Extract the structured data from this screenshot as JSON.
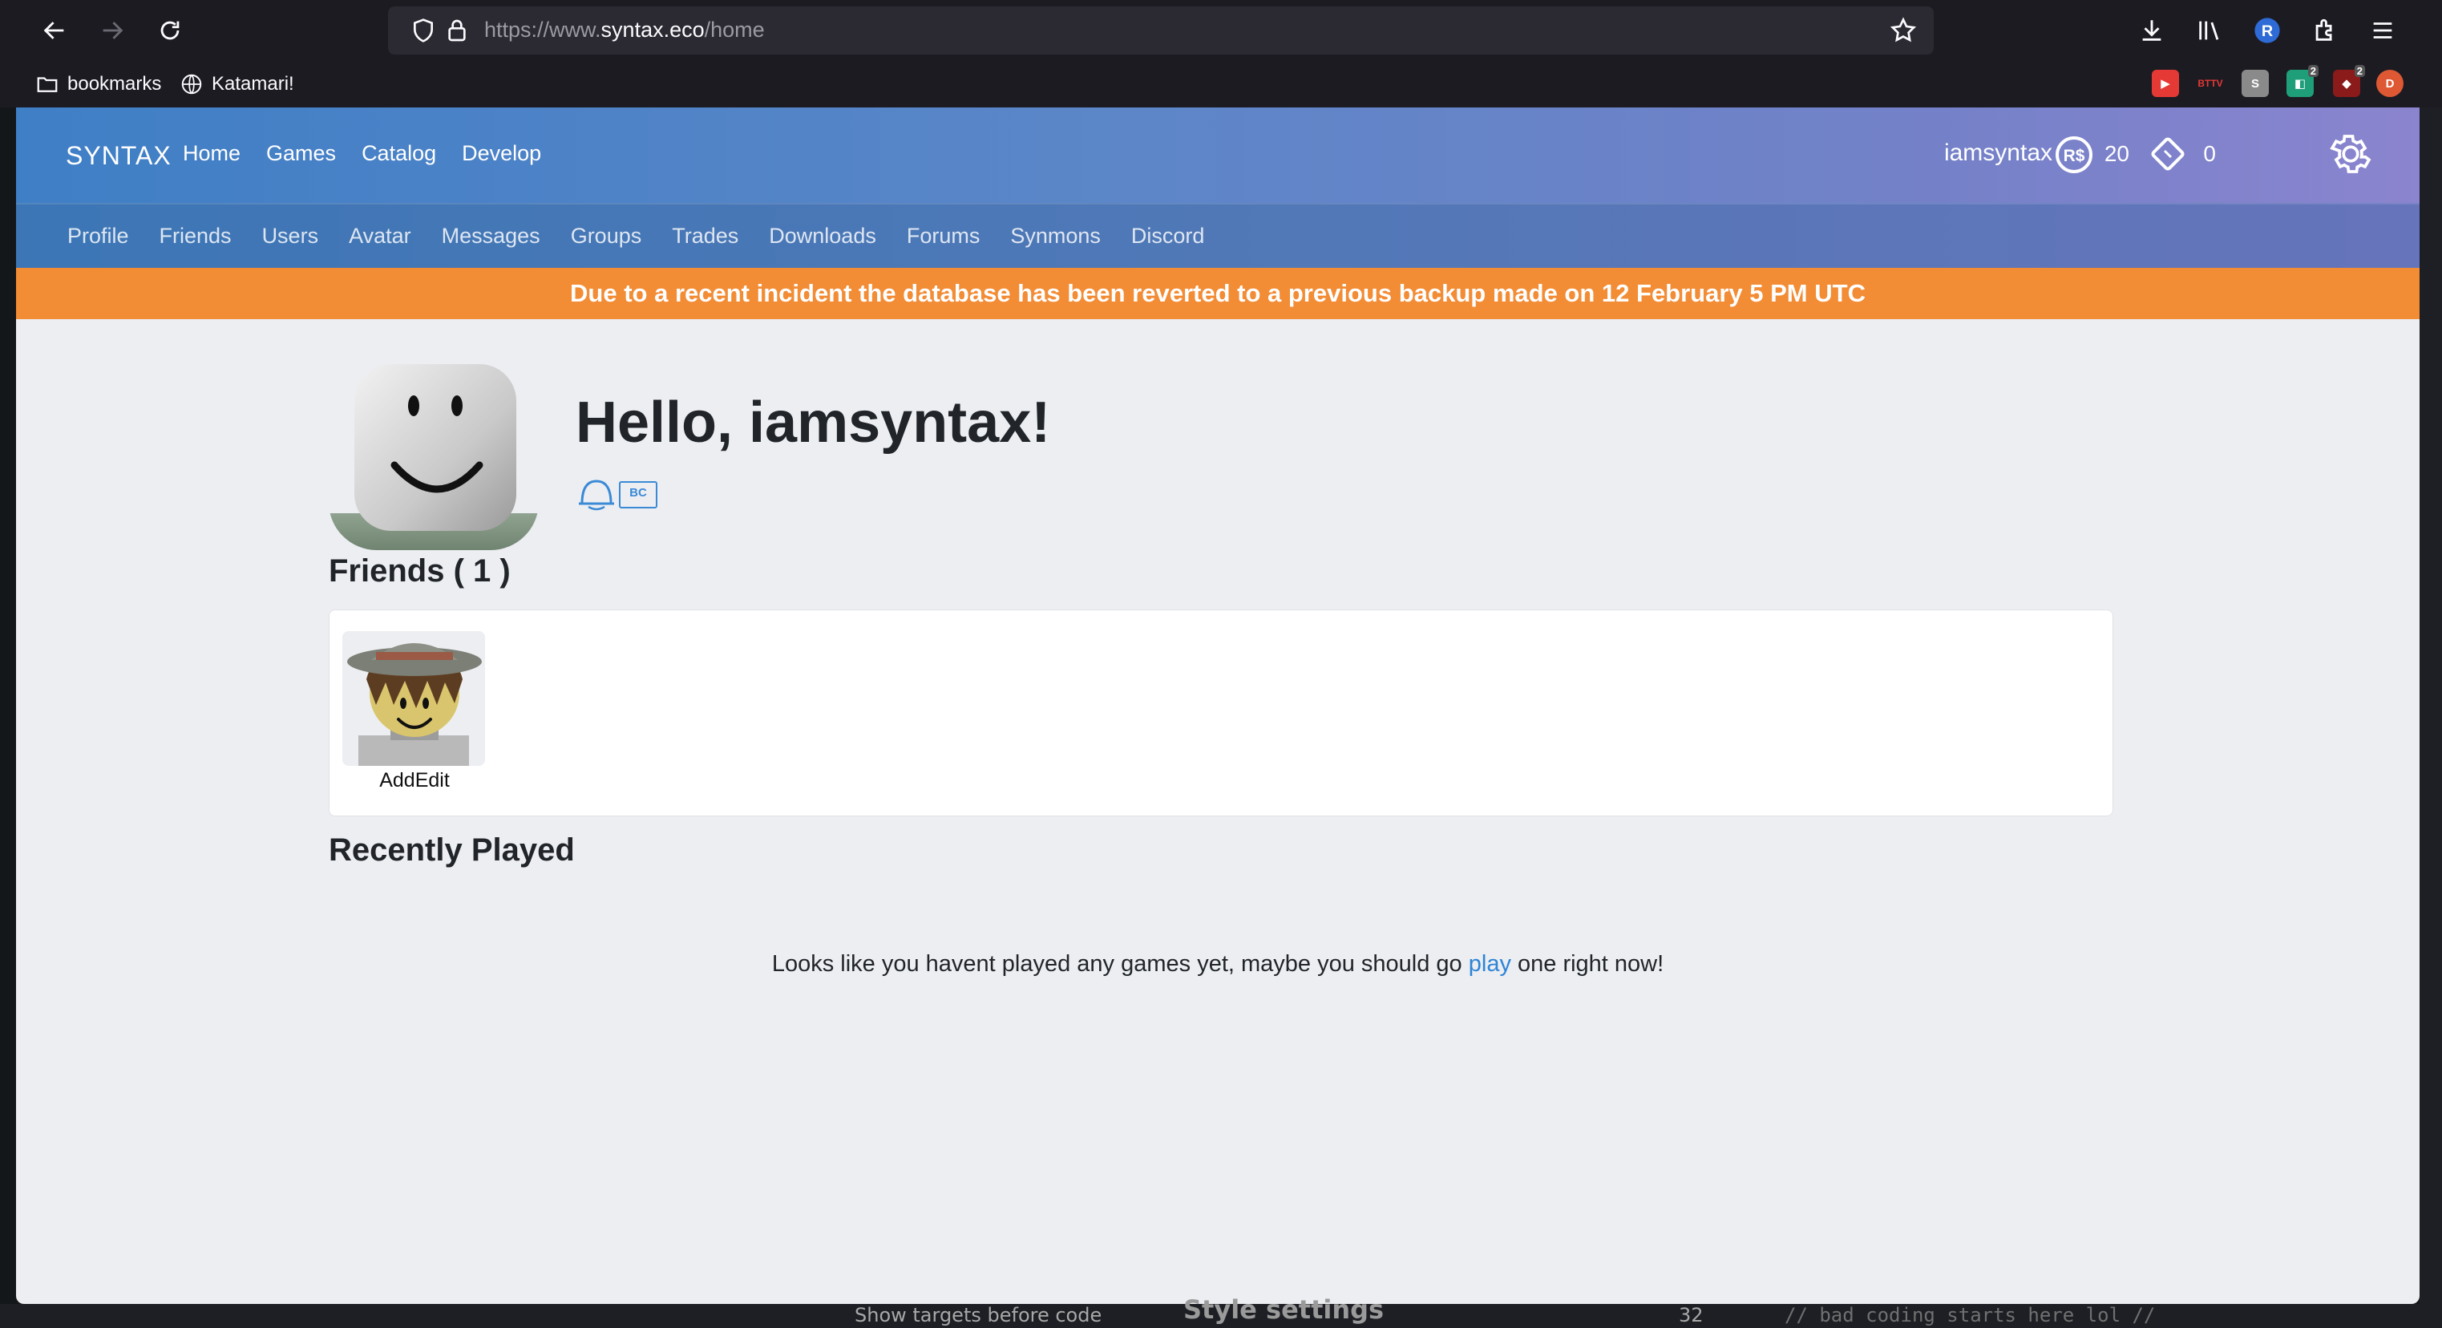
{
  "browser": {
    "url_prefix": "https://www.",
    "url_host": "syntax.eco",
    "url_path": "/home",
    "bookmarks": [
      {
        "label": "bookmarks"
      },
      {
        "label": "Katamari!"
      }
    ],
    "extensions": [
      {
        "name": "youtube-extension-icon",
        "color": "#e53935",
        "text": "▶"
      },
      {
        "name": "bttv-extension-icon",
        "color": "#1c1b22",
        "text": "BTTV"
      },
      {
        "name": "s-extension-icon",
        "color": "#777777",
        "text": "S"
      },
      {
        "name": "green-extension-icon",
        "color": "#1f9e7a",
        "text": "2"
      },
      {
        "name": "ublock-extension-icon",
        "color": "#8b1a1a",
        "text": "2"
      },
      {
        "name": "duckduckgo-extension-icon",
        "color": "#de5833",
        "text": "D"
      }
    ]
  },
  "site": {
    "brand": "SYNTAX",
    "main_nav": [
      "Home",
      "Games",
      "Catalog",
      "Develop"
    ],
    "username": "iamsyntax",
    "robux": "20",
    "tickets": "0",
    "sub_nav": [
      "Profile",
      "Friends",
      "Users",
      "Avatar",
      "Messages",
      "Groups",
      "Trades",
      "Downloads",
      "Forums",
      "Synmons",
      "Discord"
    ],
    "alert": "Due to a recent incident the database has been reverted to a previous backup made on 12 February 5 PM UTC"
  },
  "home": {
    "greeting": "Hello, iamsyntax!",
    "badge_bc": "BC",
    "friends_title": "Friends ( 1 )",
    "friends": [
      {
        "name": "AddEdit"
      }
    ],
    "recent_title": "Recently Played",
    "empty_before": "Looks like you havent played any games yet, maybe you should go ",
    "empty_link": "play",
    "empty_after": " one right now!"
  },
  "peek": {
    "left": "Show targets before code",
    "mid": "Style settings",
    "right": "// bad coding starts here lol //",
    "line": "32"
  },
  "colors": {
    "accent": "#2d84d6",
    "alert": "#f28c35"
  }
}
